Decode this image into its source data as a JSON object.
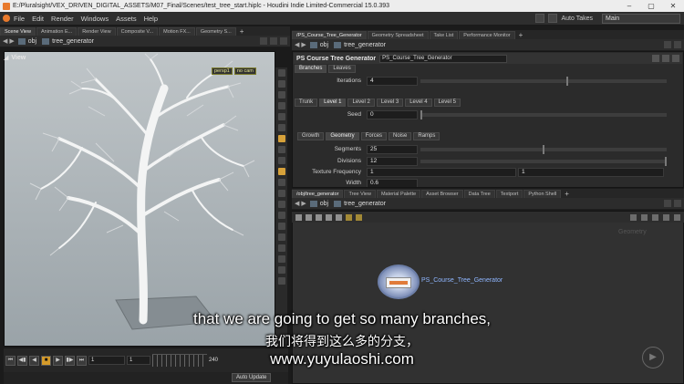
{
  "window": {
    "title": "E:/Pluralsight/VEX_DRIVEN_DIGITAL_ASSETS/M07_Final/Scenes/test_tree_start.hiplc - Houdini Indie Limited-Commercial 15.0.393"
  },
  "menu": [
    "File",
    "Edit",
    "Render",
    "Windows",
    "Assets",
    "Help"
  ],
  "toolbar": {
    "auto_takes": "Auto Takes",
    "desktop": "Main"
  },
  "left_tabs": [
    "Scene View",
    "Animation E...",
    "Render View",
    "Composite V...",
    "Motion FX...",
    "Geometry S..."
  ],
  "left_path": {
    "root": "obj",
    "node": "tree_generator"
  },
  "viewport": {
    "title": "View",
    "cam_persp": "persp1",
    "cam_nocam": "no cam"
  },
  "timeline": {
    "current": "1",
    "start": "1",
    "end": "240",
    "auto_update": "Auto Update"
  },
  "right_tabs": [
    "/PS_Course_Tree_Generator",
    "Geometry Spreadsheet",
    "Take List",
    "Performance Monitor"
  ],
  "right_path": {
    "root": "obj",
    "node": "tree_generator"
  },
  "params": {
    "node_type": "PS Course Tree Generator",
    "node_name": "PS_Course_Tree_Generator",
    "top_tabs": [
      "Branches",
      "Leaves"
    ],
    "iterations_label": "Iterations",
    "iterations_value": "4",
    "level_tabs": [
      "Trunk",
      "Level 1",
      "Level 2",
      "Level 3",
      "Level 4",
      "Level 5"
    ],
    "seed_label": "Seed",
    "seed_value": "0",
    "sub_tabs": [
      "Growth",
      "Geometry",
      "Forces",
      "Noise",
      "Ramps"
    ],
    "segments_label": "Segments",
    "segments_value": "25",
    "divisions_label": "Divisions",
    "divisions_value": "12",
    "texfreq_label": "Texture Frequency",
    "texfreq_value1": "1",
    "texfreq_value2": "1",
    "width_label": "Width",
    "width_value": "0.6"
  },
  "net_tabs": [
    "/obj/tree_generator",
    "Tree View",
    "Material Palette",
    "Asset Browser",
    "Data Tree",
    "Textport",
    "Python Shell"
  ],
  "net_path": {
    "root": "obj",
    "node": "tree_generator"
  },
  "network": {
    "node_label": "PS_Course_Tree_Generator",
    "watermark": "Geometry"
  },
  "subtitles": {
    "english": "that we are going to get so many branches,",
    "chinese": "我们将得到这么多的分支，",
    "url": "www.yuyulaoshi.com"
  }
}
